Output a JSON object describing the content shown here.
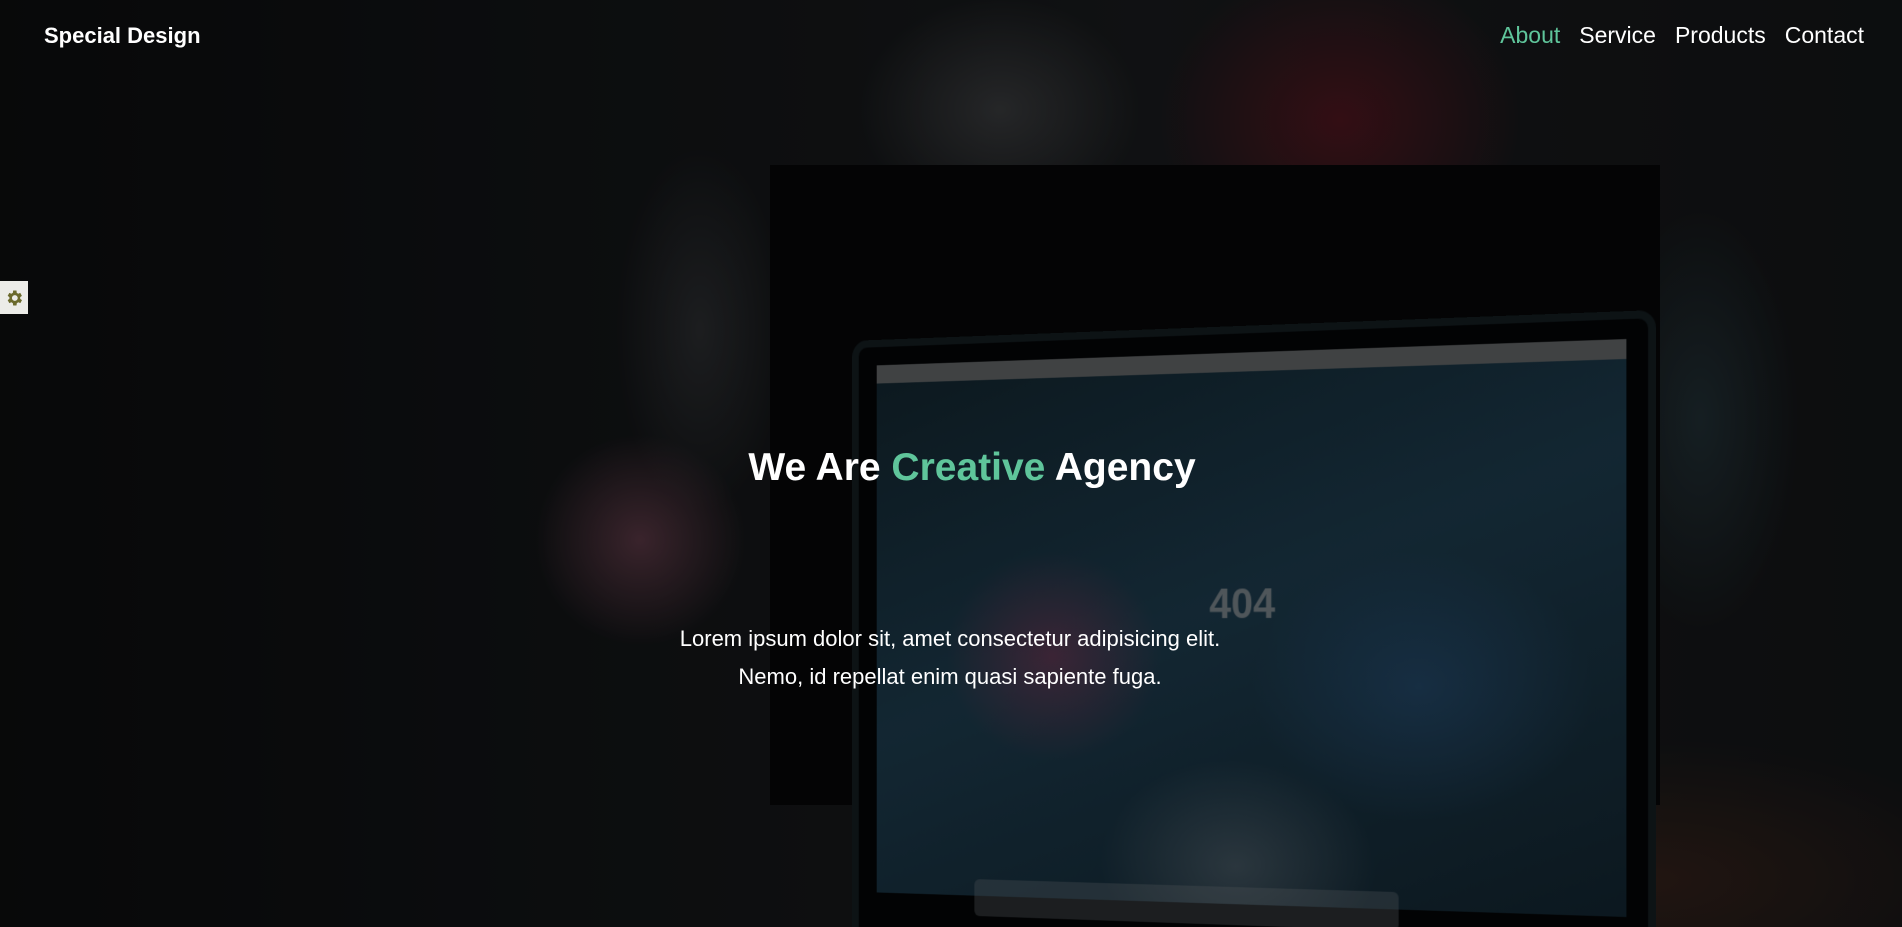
{
  "header": {
    "logo": "Special Design",
    "nav": [
      {
        "label": "About",
        "active": true
      },
      {
        "label": "Service",
        "active": false
      },
      {
        "label": "Products",
        "active": false
      },
      {
        "label": "Contact",
        "active": false
      }
    ]
  },
  "settings": {
    "icon": "gear-icon"
  },
  "hero": {
    "title_before": "We Are",
    "title_accent": "Creative",
    "title_after": "Agency",
    "description": "Lorem ipsum dolor sit, amet consectetur adipisicing elit. Nemo, id repellat enim quasi sapiente fuga."
  },
  "background_screen": {
    "error_code": "404"
  },
  "colors": {
    "accent": "#5fc59b",
    "text": "#ffffff",
    "settings_bg": "#ecece8",
    "settings_icon": "#6b6a2c"
  }
}
